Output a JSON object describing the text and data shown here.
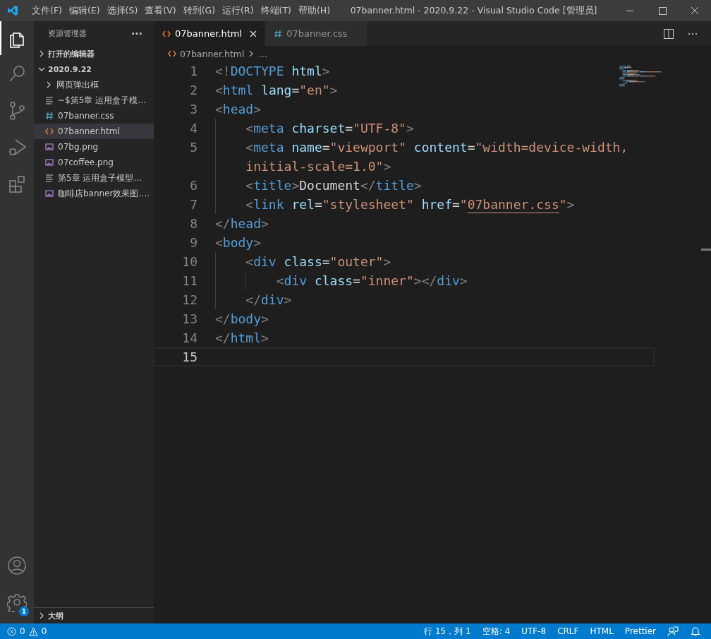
{
  "window": {
    "title": "07banner.html - 2020.9.22 - Visual Studio Code [管理员]"
  },
  "menu": [
    "文件(F)",
    "编辑(E)",
    "选择(S)",
    "查看(V)",
    "转到(G)",
    "运行(R)",
    "终端(T)",
    "帮助(H)"
  ],
  "activity_bar": [
    {
      "kind": "files",
      "selected": true
    },
    {
      "kind": "search",
      "selected": false
    },
    {
      "kind": "source-control",
      "selected": false
    },
    {
      "kind": "debug",
      "selected": false
    },
    {
      "kind": "extensions",
      "selected": false
    }
  ],
  "activity_bottom": [
    {
      "kind": "account"
    },
    {
      "kind": "settings",
      "badge": "1"
    }
  ],
  "sidebar": {
    "title": "资源管理器",
    "more": "···",
    "sections": [
      {
        "title": "打开的编辑器",
        "expanded": false
      },
      {
        "title": "2020.9.22",
        "expanded": true,
        "children": [
          {
            "label": "网页弹出框",
            "kind": "folder",
            "selected": false
          },
          {
            "label": "~$第5章 运用盒子模…",
            "kind": "text",
            "selected": false
          },
          {
            "label": "07banner.css",
            "kind": "css",
            "selected": false
          },
          {
            "label": "07banner.html",
            "kind": "html",
            "selected": true
          },
          {
            "label": "07bg.png",
            "kind": "image",
            "selected": false
          },
          {
            "label": "07coffee.png",
            "kind": "image",
            "selected": false
          },
          {
            "label": "第5章 运用盒子模型…",
            "kind": "text",
            "selected": false
          },
          {
            "label": "咖啡店banner效果图.…",
            "kind": "image",
            "selected": false
          }
        ]
      }
    ],
    "outline": {
      "title": "大纲",
      "expanded": false
    }
  },
  "tabs": [
    {
      "label": "07banner.html",
      "kind": "html",
      "selected": true
    },
    {
      "label": "07banner.css",
      "kind": "css",
      "selected": false
    }
  ],
  "breadcrumb": [
    "07banner.html",
    "…"
  ],
  "code": [
    {
      "number": "1",
      "current": false,
      "rows": [
        [
          {
            "kind": "p",
            "text": "<!"
          },
          {
            "kind": "tag",
            "text": "DOCTYPE"
          },
          {
            "kind": "text",
            "text": " "
          },
          {
            "kind": "attr",
            "text": "html"
          },
          {
            "kind": "p",
            "text": ">"
          }
        ]
      ]
    },
    {
      "number": "2",
      "current": false,
      "rows": [
        [
          {
            "kind": "p",
            "text": "<"
          },
          {
            "kind": "tag",
            "text": "html"
          },
          {
            "kind": "text",
            "text": " "
          },
          {
            "kind": "attr",
            "text": "lang"
          },
          {
            "kind": "text",
            "text": "="
          },
          {
            "kind": "str",
            "text": "\"en\""
          },
          {
            "kind": "p",
            "text": ">"
          }
        ]
      ]
    },
    {
      "number": "3",
      "current": false,
      "rows": [
        [
          {
            "kind": "p",
            "text": "<"
          },
          {
            "kind": "tag",
            "text": "head"
          },
          {
            "kind": "p",
            "text": ">"
          }
        ]
      ]
    },
    {
      "number": "4",
      "current": false,
      "rows": [
        [
          {
            "kind": "p",
            "text": "    <"
          },
          {
            "kind": "tag",
            "text": "meta"
          },
          {
            "kind": "text",
            "text": " "
          },
          {
            "kind": "attr",
            "text": "charset"
          },
          {
            "kind": "text",
            "text": "="
          },
          {
            "kind": "str",
            "text": "\"UTF-8\""
          },
          {
            "kind": "p",
            "text": ">"
          }
        ]
      ]
    },
    {
      "number": "5",
      "current": false,
      "rows": [
        [
          {
            "kind": "p",
            "text": "    <"
          },
          {
            "kind": "tag",
            "text": "meta"
          },
          {
            "kind": "text",
            "text": " "
          },
          {
            "kind": "attr",
            "text": "name"
          },
          {
            "kind": "text",
            "text": "="
          },
          {
            "kind": "str",
            "text": "\"viewport\""
          },
          {
            "kind": "text",
            "text": " "
          },
          {
            "kind": "attr",
            "text": "content"
          },
          {
            "kind": "text",
            "text": "="
          },
          {
            "kind": "str",
            "text": "\"width=device-width,"
          }
        ]
      ],
      "wrapped": [
        {
          "kind": "str",
          "text": "    initial-scale=1.0\""
        },
        {
          "kind": "p",
          "text": ">"
        }
      ]
    },
    {
      "number": "6",
      "current": false,
      "rows": [
        [
          {
            "kind": "p",
            "text": "    <"
          },
          {
            "kind": "tag",
            "text": "title"
          },
          {
            "kind": "p",
            "text": ">"
          },
          {
            "kind": "text",
            "text": "Document"
          },
          {
            "kind": "p",
            "text": "</"
          },
          {
            "kind": "tag",
            "text": "title"
          },
          {
            "kind": "p",
            "text": ">"
          }
        ]
      ]
    },
    {
      "number": "7",
      "current": false,
      "rows": [
        [
          {
            "kind": "p",
            "text": "    <"
          },
          {
            "kind": "tag",
            "text": "link"
          },
          {
            "kind": "text",
            "text": " "
          },
          {
            "kind": "attr",
            "text": "rel"
          },
          {
            "kind": "text",
            "text": "="
          },
          {
            "kind": "str",
            "text": "\"stylesheet\""
          },
          {
            "kind": "text",
            "text": " "
          },
          {
            "kind": "attr",
            "text": "href"
          },
          {
            "kind": "text",
            "text": "="
          },
          {
            "kind": "str",
            "text": "\""
          },
          {
            "kind": "link",
            "text": "07banner.css"
          },
          {
            "kind": "str",
            "text": "\""
          },
          {
            "kind": "p",
            "text": ">"
          }
        ]
      ]
    },
    {
      "number": "8",
      "current": false,
      "rows": [
        [
          {
            "kind": "p",
            "text": "</"
          },
          {
            "kind": "tag",
            "text": "head"
          },
          {
            "kind": "p",
            "text": ">"
          }
        ]
      ]
    },
    {
      "number": "9",
      "current": false,
      "rows": [
        [
          {
            "kind": "p",
            "text": "<"
          },
          {
            "kind": "tag",
            "text": "body"
          },
          {
            "kind": "p",
            "text": ">"
          }
        ]
      ]
    },
    {
      "number": "10",
      "current": false,
      "rows": [
        [
          {
            "kind": "p",
            "text": "    <"
          },
          {
            "kind": "tag",
            "text": "div"
          },
          {
            "kind": "text",
            "text": " "
          },
          {
            "kind": "attr",
            "text": "class"
          },
          {
            "kind": "text",
            "text": "="
          },
          {
            "kind": "str",
            "text": "\"outer\""
          },
          {
            "kind": "p",
            "text": ">"
          }
        ]
      ]
    },
    {
      "number": "11",
      "current": false,
      "rows": [
        [
          {
            "kind": "p",
            "text": "        <"
          },
          {
            "kind": "tag",
            "text": "div"
          },
          {
            "kind": "text",
            "text": " "
          },
          {
            "kind": "attr",
            "text": "class"
          },
          {
            "kind": "text",
            "text": "="
          },
          {
            "kind": "str",
            "text": "\"inner\""
          },
          {
            "kind": "p",
            "text": "></"
          },
          {
            "kind": "tag",
            "text": "div"
          },
          {
            "kind": "p",
            "text": ">"
          }
        ]
      ]
    },
    {
      "number": "12",
      "current": false,
      "rows": [
        [
          {
            "kind": "p",
            "text": "    </"
          },
          {
            "kind": "tag",
            "text": "div"
          },
          {
            "kind": "p",
            "text": ">"
          }
        ]
      ]
    },
    {
      "number": "13",
      "current": false,
      "rows": [
        [
          {
            "kind": "p",
            "text": "</"
          },
          {
            "kind": "tag",
            "text": "body"
          },
          {
            "kind": "p",
            "text": ">"
          }
        ]
      ]
    },
    {
      "number": "14",
      "current": false,
      "rows": [
        [
          {
            "kind": "p",
            "text": "</"
          },
          {
            "kind": "tag",
            "text": "html"
          },
          {
            "kind": "p",
            "text": ">"
          }
        ]
      ]
    },
    {
      "number": "15",
      "current": true,
      "rows": [
        []
      ]
    }
  ],
  "status_bar": {
    "errors": "0",
    "warnings": "0",
    "items": [
      "行 15，列 1",
      "空格: 4",
      "UTF-8",
      "CRLF",
      "HTML",
      "Prettier"
    ]
  }
}
